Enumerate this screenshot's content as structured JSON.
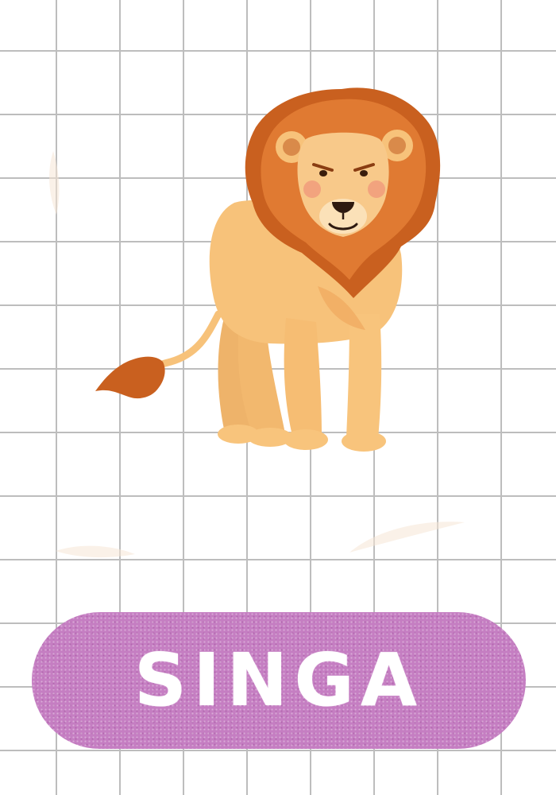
{
  "card": {
    "word": "SINGA",
    "illustration": "lion-illustration",
    "colors": {
      "pill": "#c57ec2",
      "word": "#ffffff",
      "grid": "#bdbdbd",
      "mane": "#c9601f",
      "body": "#f7c27a"
    }
  }
}
